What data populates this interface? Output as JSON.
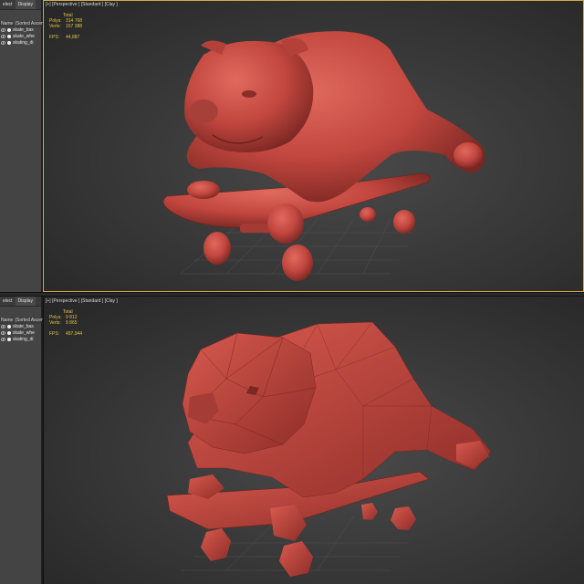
{
  "explorer": {
    "tabs": [
      "elect",
      "Display"
    ],
    "columns": [
      "Name",
      "(Sorted Ascen"
    ],
    "items": [
      "skate_bas",
      "skate_whe",
      "skating_di"
    ]
  },
  "top_viewport": {
    "label": "[+] [Perspective ] [Standard ] [Clay ]",
    "stats_title": "Total",
    "polys_label": "Polys:",
    "polys_value": "314 768",
    "verts_label": "Verts:",
    "verts_value": "157 388",
    "fps_label": "FPS:",
    "fps_value": "44,887"
  },
  "bottom_viewport": {
    "label": "[+] [Perspective ] [Standard ] [Clay ]",
    "stats_title": "Total",
    "polys_label": "Polys:",
    "polys_value": "9 812",
    "verts_label": "Verts:",
    "verts_value": "9 865",
    "fps_label": "FPS:",
    "fps_value": "497,944"
  },
  "colors": {
    "clay": "#c2473f",
    "active_border": "#d5a94a",
    "stats": "#e3c24a"
  }
}
